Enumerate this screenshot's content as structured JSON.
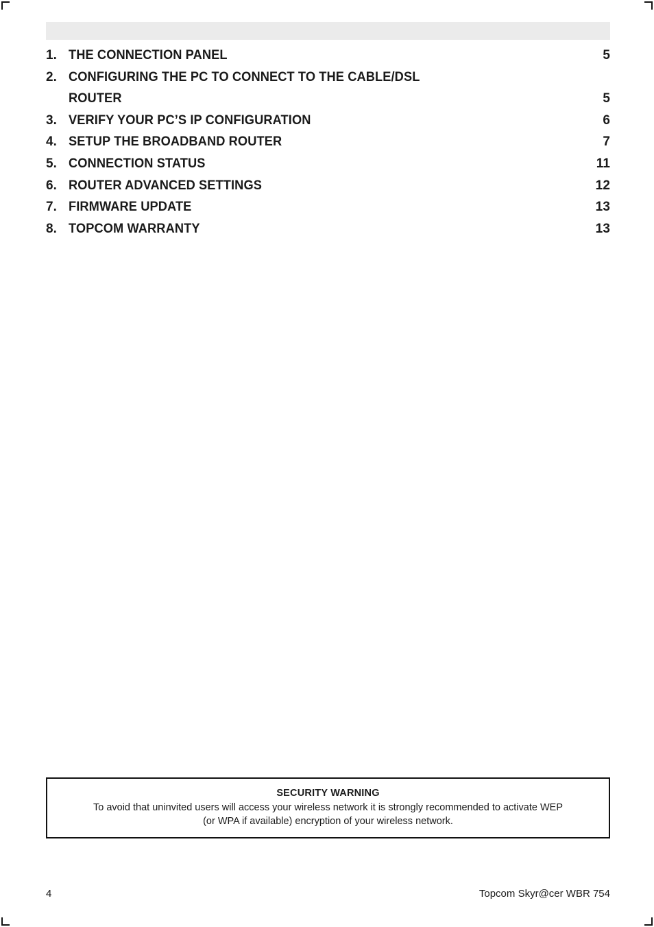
{
  "document": {
    "header_band_color": "#ebebeb",
    "page_background": "#ffffff",
    "text_color": "#1a1a1a"
  },
  "toc": {
    "entries": [
      {
        "number": "1.",
        "label": "THE CONNECTION PANEL",
        "page": "5",
        "continuation": ""
      },
      {
        "number": "2.",
        "label": "CONFIGURING THE PC TO CONNECT TO THE CABLE/DSL",
        "page": "",
        "continuation": "ROUTER",
        "continuation_page": "5"
      },
      {
        "number": "3.",
        "label": "VERIFY YOUR PC’S IP CONFIGURATION",
        "page": "6",
        "continuation": ""
      },
      {
        "number": "4.",
        "label": "SETUP THE BROADBAND ROUTER",
        "page": "7",
        "continuation": ""
      },
      {
        "number": "5.",
        "label": "CONNECTION STATUS",
        "page": "11",
        "continuation": ""
      },
      {
        "number": "6.",
        "label": "ROUTER ADVANCED SETTINGS",
        "page": "12",
        "continuation": ""
      },
      {
        "number": "7.",
        "label": "FIRMWARE UPDATE",
        "page": "13",
        "continuation": ""
      },
      {
        "number": "8.",
        "label": "TOPCOM WARRANTY",
        "page": "13",
        "continuation": ""
      }
    ]
  },
  "security_warning": {
    "title": "SECURITY WARNING",
    "body": "To avoid that uninvited users will access your wireless network it is strongly recommended to activate WEP\n(or WPA if available)  encryption of your wireless network."
  },
  "footer": {
    "page_number": "4",
    "product": "Topcom Skyr@cer WBR 754"
  }
}
